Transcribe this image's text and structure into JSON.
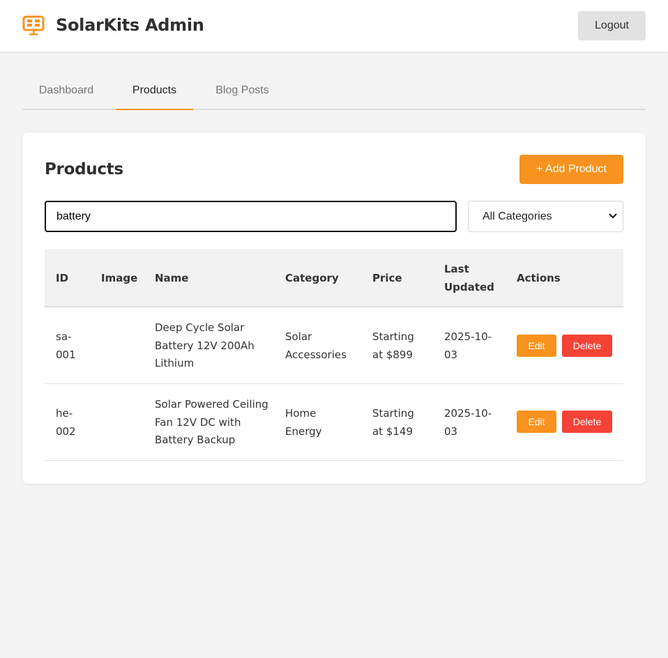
{
  "app": {
    "title": "SolarKits Admin",
    "brand_icon": "solar-panel-icon",
    "accent_color": "#f7931e",
    "danger_color": "#f44336"
  },
  "header": {
    "logout_label": "Logout"
  },
  "tabs": [
    {
      "label": "Dashboard",
      "active": false
    },
    {
      "label": "Products",
      "active": true
    },
    {
      "label": "Blog Posts",
      "active": false
    }
  ],
  "products_panel": {
    "title": "Products",
    "add_label": "+ Add Product",
    "search_value": "battery",
    "category_selected": "All Categories"
  },
  "table": {
    "columns": [
      "ID",
      "Image",
      "Name",
      "Category",
      "Price",
      "Last Updated",
      "Actions"
    ],
    "rows": [
      {
        "id": "sa-001",
        "image": "",
        "name": "Deep Cycle Solar Battery 12V 200Ah Lithium",
        "category": "Solar Accessories",
        "price": "Starting at $899",
        "last_updated": "2025-10-03",
        "edit_label": "Edit",
        "delete_label": "Delete"
      },
      {
        "id": "he-002",
        "image": "",
        "name": "Solar Powered Ceiling Fan 12V DC with Battery Backup",
        "category": "Home Energy",
        "price": "Starting at $149",
        "last_updated": "2025-10-03",
        "edit_label": "Edit",
        "delete_label": "Delete"
      }
    ]
  }
}
